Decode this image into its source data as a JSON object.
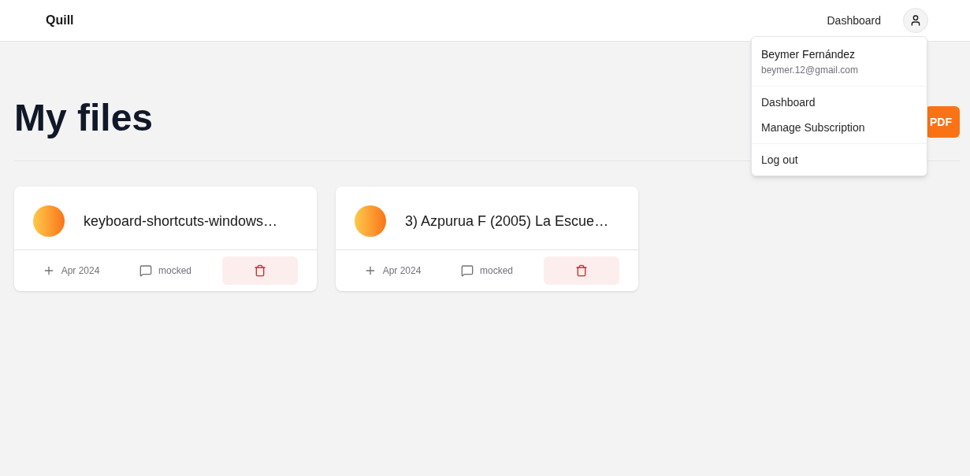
{
  "navbar": {
    "brand": "Quill",
    "links": [
      "Dashboard"
    ]
  },
  "header": {
    "title": "My files",
    "upload_button": "PDF"
  },
  "files": [
    {
      "name": "keyboard-shortcuts-windows…",
      "date": "Apr 2024",
      "comments": "mocked"
    },
    {
      "name": "3) Azpurua F (2005) La Escue…",
      "date": "Apr 2024",
      "comments": "mocked"
    }
  ],
  "user_menu": {
    "name": "Beymer Fernández",
    "email": "beymer.12@gmail.com",
    "sections": [
      {
        "items": [
          "Dashboard",
          "Manage Subscription"
        ]
      },
      {
        "items": [
          "Log out"
        ]
      }
    ]
  }
}
